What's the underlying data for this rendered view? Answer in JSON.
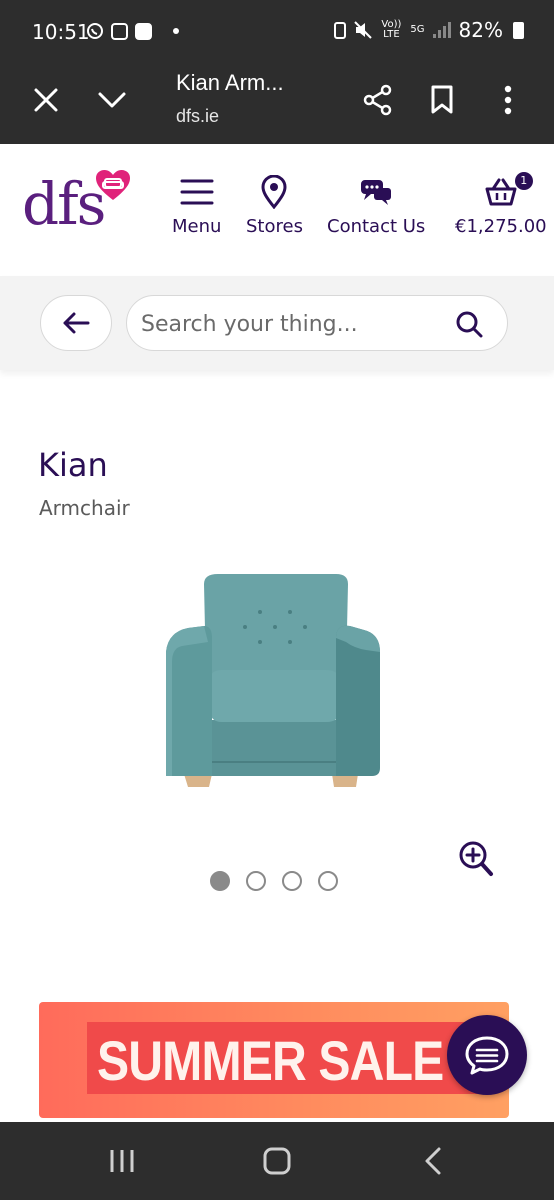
{
  "status_bar": {
    "time": "10:51",
    "volte_label": "Vo)) LTE",
    "network_label": "5G",
    "battery": "82%"
  },
  "browser": {
    "title": "Kian Arm...",
    "url": "dfs.ie",
    "icons": [
      "close-icon",
      "chevron-down-icon",
      "share-icon",
      "bookmark-icon",
      "more-vert-icon"
    ]
  },
  "header": {
    "logo_text": "dfs",
    "menu_label": "Menu",
    "stores_label": "Stores",
    "contact_label": "Contact Us",
    "basket_total": "€1,275.00",
    "basket_count": "1"
  },
  "search": {
    "placeholder": "Search your thing..."
  },
  "product": {
    "name": "Kian",
    "type": "Armchair",
    "image_index": 1,
    "image_count": 4
  },
  "banner": {
    "text": "SUMMER SALE"
  },
  "colors": {
    "brand_purple": "#2a0e55",
    "logo_purple": "#5a1f7e",
    "heart_pink": "#e0237a",
    "banner_orange": "#ff8a5e",
    "armchair_teal": "#5e9a9c"
  }
}
